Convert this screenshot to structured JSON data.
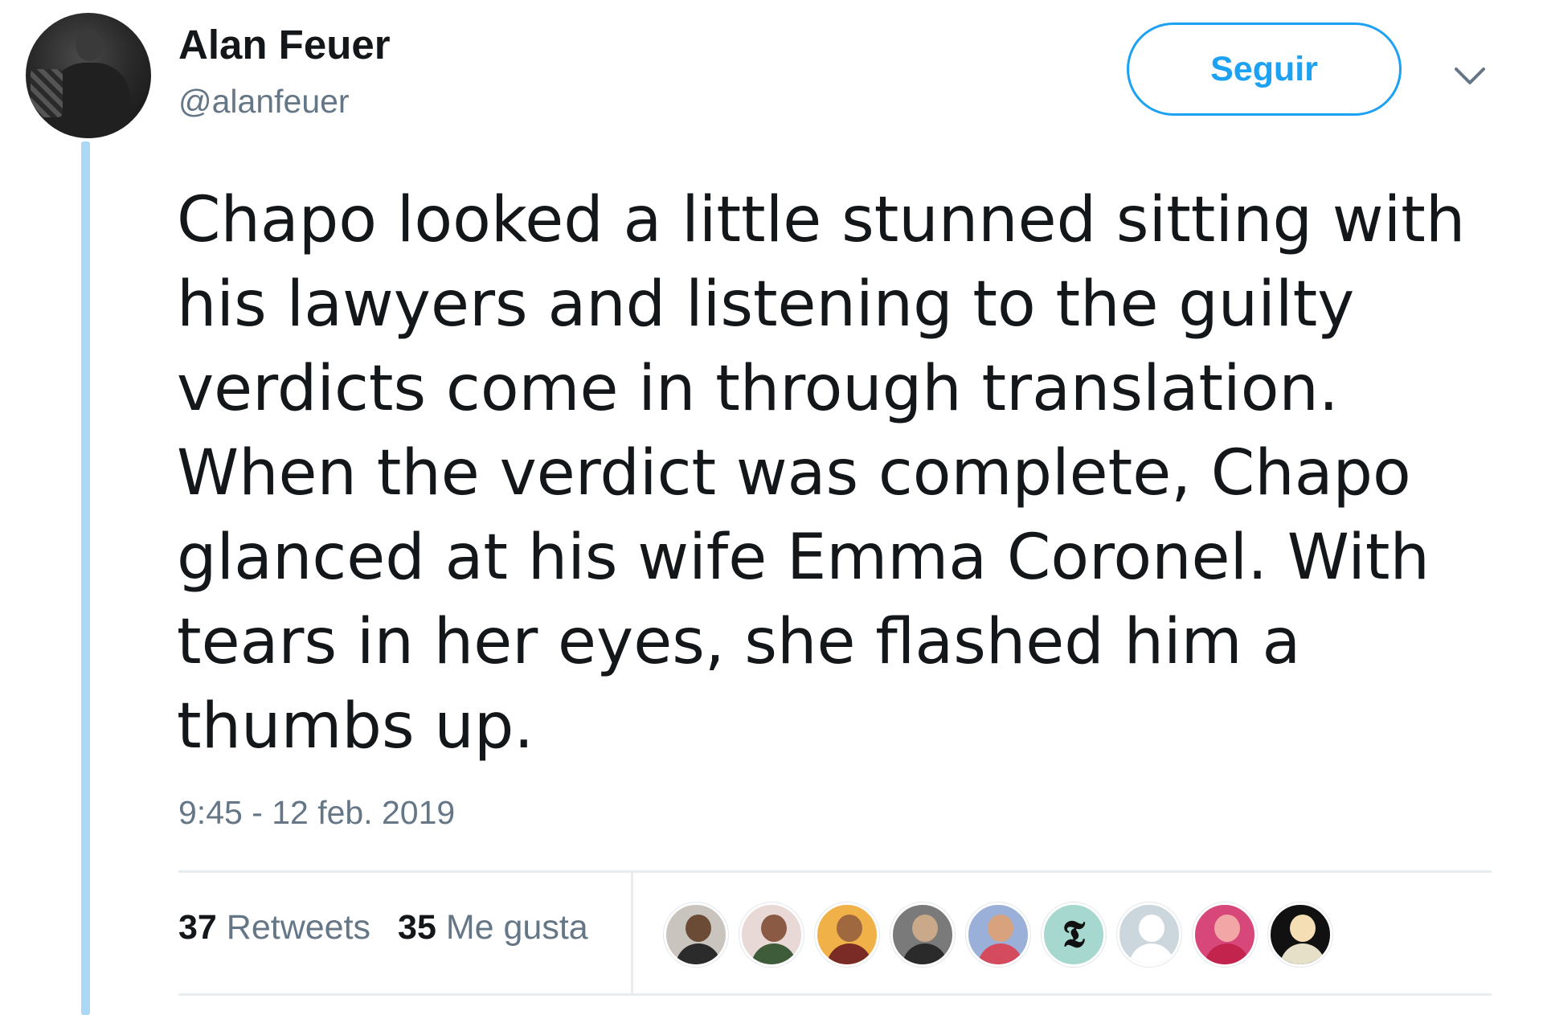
{
  "author": {
    "name": "Alan Feuer",
    "handle": "@alanfeuer"
  },
  "follow_button": {
    "label": "Seguir"
  },
  "tweet": {
    "lines": [
      "Chapo looked a little stunned sitting with",
      "his lawyers and listening to the guilty",
      "verdicts come in through translation.",
      "When the verdict was complete, Chapo",
      "glanced at his wife Emma Coronel. With",
      "tears in her eyes, she flashed him a",
      "thumbs up."
    ],
    "timestamp": "9:45 - 12 feb. 2019"
  },
  "stats": {
    "retweets_count": "37",
    "retweets_label": " Retweets",
    "likes_count": "35",
    "likes_label": " Me gusta"
  },
  "likers": [
    {
      "name": "liker-avatar-1",
      "bg": "#c9c4bd",
      "head": "#6b4a36",
      "body": "#2b2b2b"
    },
    {
      "name": "liker-avatar-2",
      "bg": "#e8d9d6",
      "head": "#8a5a44",
      "body": "#3e5b3a"
    },
    {
      "name": "liker-avatar-3",
      "bg": "#f0b248",
      "head": "#a0683e",
      "body": "#7a2b25"
    },
    {
      "name": "liker-avatar-4",
      "bg": "#7a7a7a",
      "head": "#c9a98a",
      "body": "#2a2a2a"
    },
    {
      "name": "liker-avatar-5",
      "bg": "#9ab0d8",
      "head": "#d8a27e",
      "body": "#d34b5c"
    },
    {
      "name": "liker-avatar-7",
      "bg": "#ccd6dd",
      "head": "#ffffff",
      "body": "#ffffff"
    },
    {
      "name": "liker-avatar-8",
      "bg": "#d8477a",
      "head": "#f2a6a6",
      "body": "#c2244e"
    },
    {
      "name": "liker-avatar-9",
      "bg": "#111111",
      "head": "#f5deb3",
      "body": "#e6e0c8"
    }
  ],
  "colors": {
    "accent": "#1da1f2",
    "thread_line": "#aad8f5",
    "secondary_text": "#657786"
  }
}
